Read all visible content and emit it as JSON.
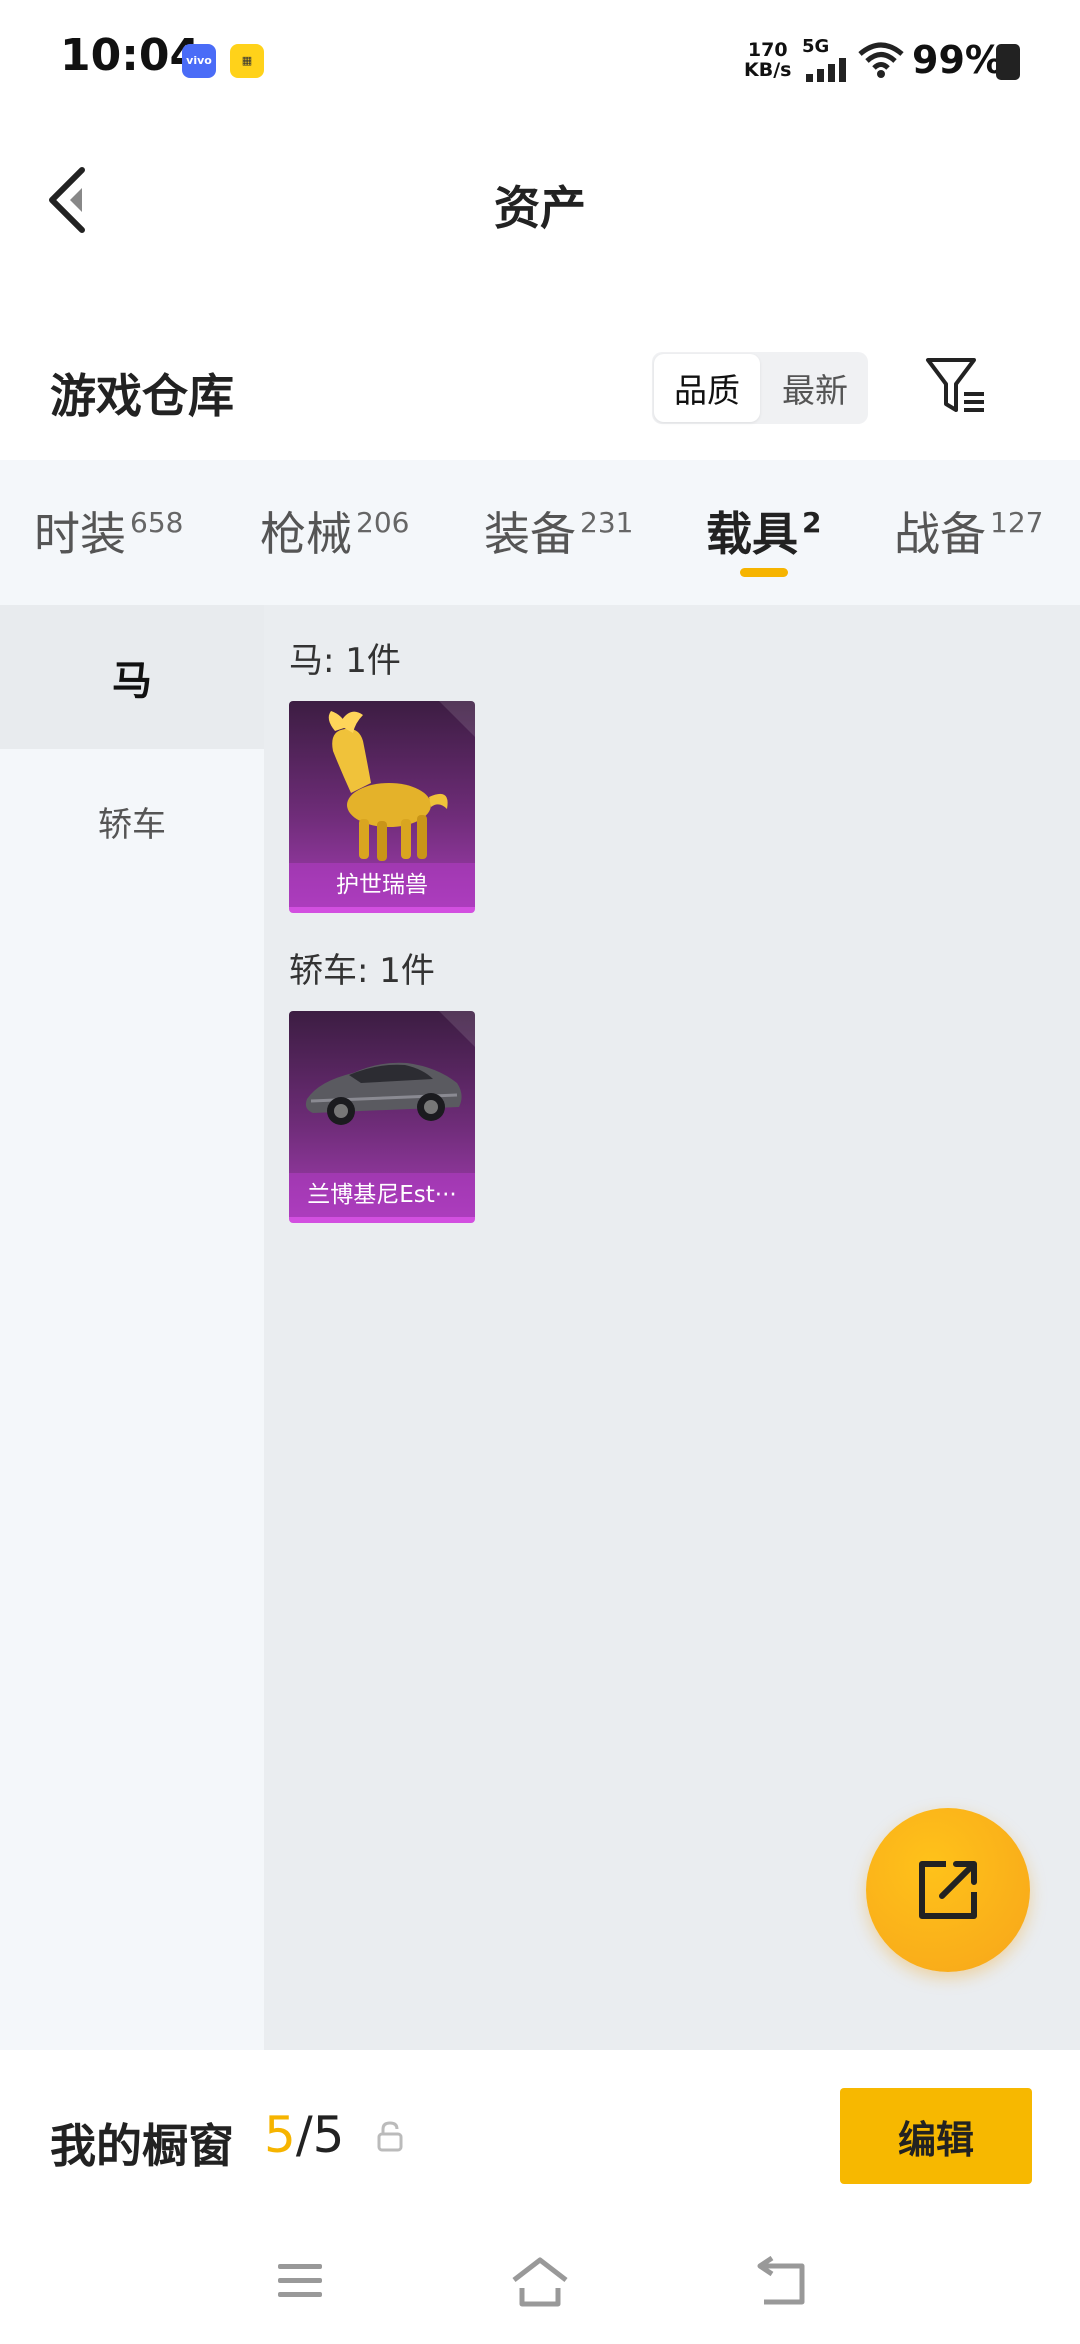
{
  "status": {
    "time": "10:04",
    "speed_value": "170",
    "speed_unit": "KB/s",
    "network": "5G",
    "battery": "99%"
  },
  "header": {
    "title": "资产"
  },
  "warehouse": {
    "title": "游戏仓库",
    "sort": [
      "品质",
      "最新"
    ],
    "active_sort": "品质"
  },
  "tabs": [
    {
      "label": "时装",
      "count": "658"
    },
    {
      "label": "枪械",
      "count": "206"
    },
    {
      "label": "装备",
      "count": "231"
    },
    {
      "label": "载具",
      "count": "2"
    },
    {
      "label": "战备",
      "count": "127"
    }
  ],
  "active_tab": "载具",
  "sidebar": {
    "items": [
      {
        "label": "马"
      },
      {
        "label": "轿车"
      }
    ]
  },
  "groups": [
    {
      "label": "马: 1件",
      "items": [
        {
          "name": "护世瑞兽"
        }
      ]
    },
    {
      "label": "轿车: 1件",
      "items": [
        {
          "name": "兰博基尼Est···"
        }
      ]
    }
  ],
  "showcase": {
    "title": "我的橱窗",
    "used": "5",
    "separator": "/",
    "total": "5",
    "edit_label": "编辑"
  },
  "colors": {
    "accent": "#f6b400",
    "card_purple": "#8e35a0"
  }
}
